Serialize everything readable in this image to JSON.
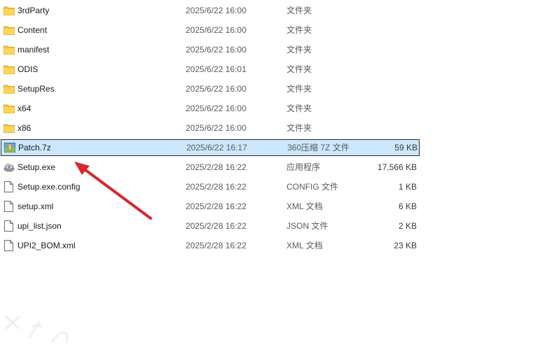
{
  "files": [
    {
      "name": "3rdParty",
      "date": "2025/6/22 16:00",
      "type": "文件夹",
      "size": "",
      "icon": "folder-icon"
    },
    {
      "name": "Content",
      "date": "2025/6/22 16:00",
      "type": "文件夹",
      "size": "",
      "icon": "folder-icon"
    },
    {
      "name": "manifest",
      "date": "2025/6/22 16:00",
      "type": "文件夹",
      "size": "",
      "icon": "folder-icon"
    },
    {
      "name": "ODIS",
      "date": "2025/6/22 16:01",
      "type": "文件夹",
      "size": "",
      "icon": "folder-icon"
    },
    {
      "name": "SetupRes",
      "date": "2025/6/22 16:00",
      "type": "文件夹",
      "size": "",
      "icon": "folder-icon"
    },
    {
      "name": "x64",
      "date": "2025/6/22 16:00",
      "type": "文件夹",
      "size": "",
      "icon": "folder-icon"
    },
    {
      "name": "x86",
      "date": "2025/6/22 16:00",
      "type": "文件夹",
      "size": "",
      "icon": "folder-icon"
    },
    {
      "name": "Patch.7z",
      "date": "2025/6/22 16:17",
      "type": "360压缩 7Z 文件",
      "size": "59 KB",
      "icon": "archive-icon",
      "selected": true
    },
    {
      "name": "Setup.exe",
      "date": "2025/2/28 16:22",
      "type": "应用程序",
      "size": "17,566 KB",
      "icon": "setup-exe-icon"
    },
    {
      "name": "Setup.exe.config",
      "date": "2025/2/28 16:22",
      "type": "CONFIG 文件",
      "size": "1 KB",
      "icon": "document-icon"
    },
    {
      "name": "setup.xml",
      "date": "2025/2/28 16:22",
      "type": "XML 文档",
      "size": "6 KB",
      "icon": "document-icon"
    },
    {
      "name": "upi_list.json",
      "date": "2025/2/28 16:22",
      "type": "JSON 文件",
      "size": "2 KB",
      "icon": "document-icon"
    },
    {
      "name": "UPI2_BOM.xml",
      "date": "2025/2/28 16:22",
      "type": "XML 文档",
      "size": "23 KB",
      "icon": "document-icon"
    }
  ],
  "colors": {
    "selection": "#cce8ff",
    "folder": "#f5c242",
    "arrow": "#d8262e"
  },
  "annotation_icon": "red-arrow-icon"
}
